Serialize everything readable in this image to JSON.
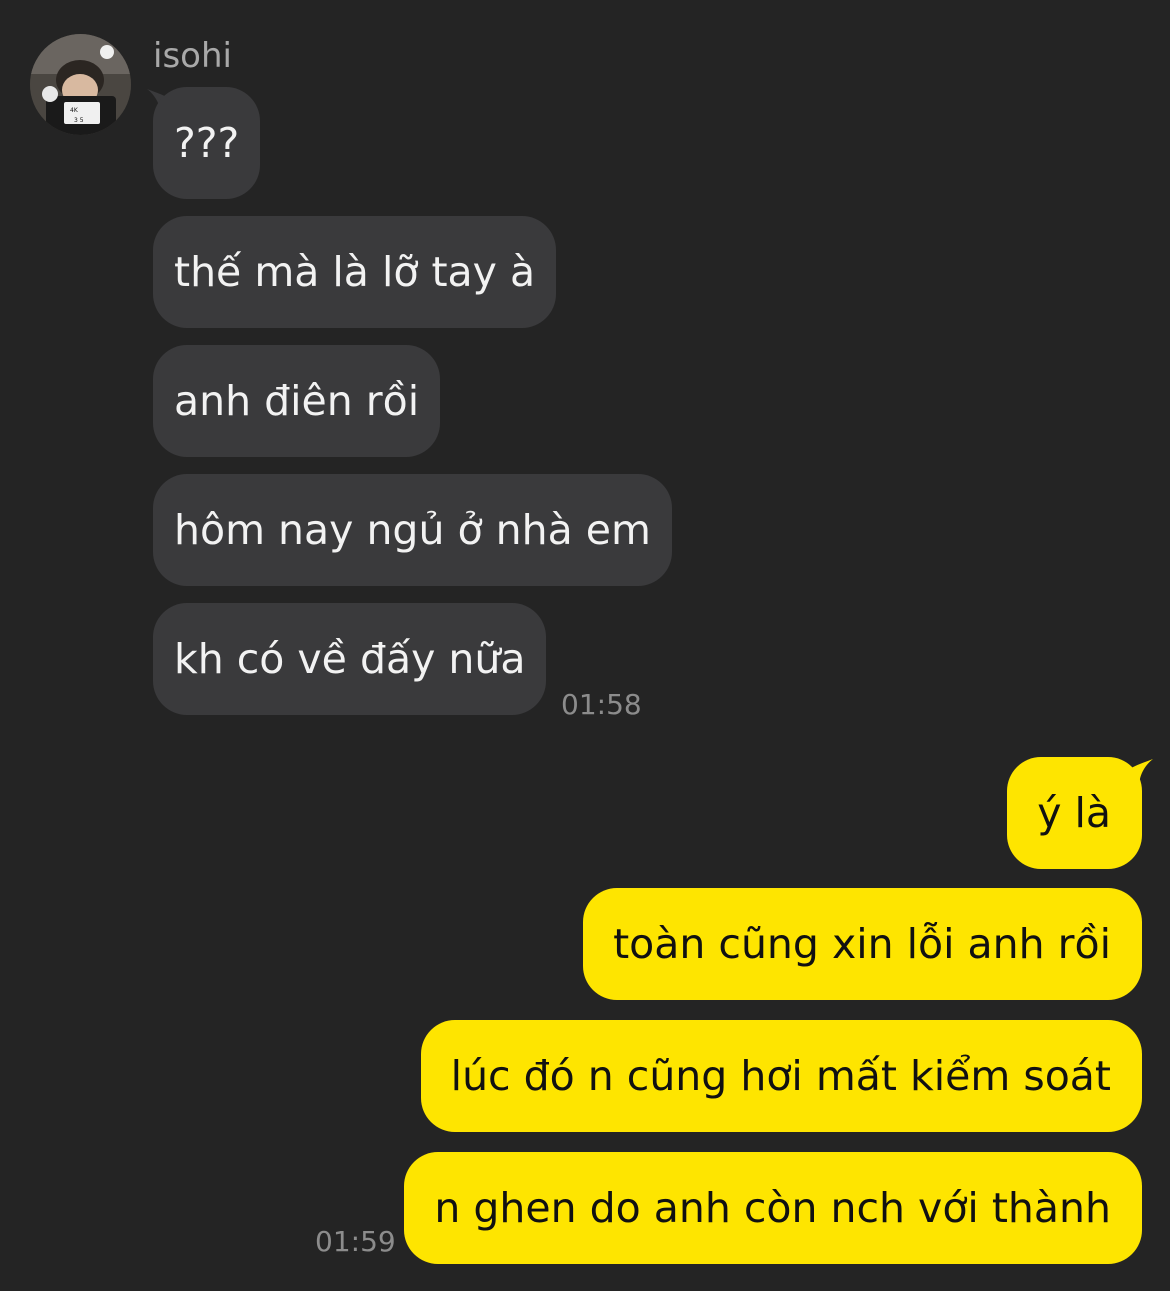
{
  "contact": {
    "name": "isohi"
  },
  "incoming": {
    "messages": [
      "???",
      "thế mà là lỡ tay à",
      "anh điên rồi",
      "hôm nay ngủ ở nhà em",
      "kh có về đấy nữa"
    ],
    "time": "01:58"
  },
  "outgoing": {
    "messages": [
      "ý là",
      "toàn cũng xin lỗi anh rồi",
      "lúc đó n cũng hơi mất kiểm soát",
      "n ghen do anh còn nch với thành"
    ],
    "time": "01:59"
  },
  "colors": {
    "background": "#242424",
    "incoming_bubble": "#3a3a3c",
    "outgoing_bubble": "#fee500"
  }
}
